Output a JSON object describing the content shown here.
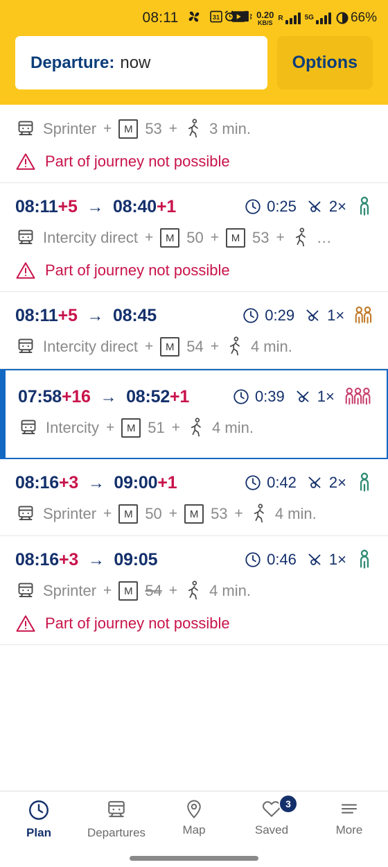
{
  "status_bar": {
    "time": "08:11",
    "left_icons": [
      "photos-pinwheel-icon",
      "calendar-icon",
      "youtube-icon"
    ],
    "calendar_day": "31",
    "alarm_icon": "alarm-icon",
    "vibrate_icon": "vibrate-icon",
    "data_rate_value": "0.20",
    "data_rate_unit": "KB/S",
    "roaming_label": "R",
    "network_label": "5G",
    "battery_percent": "66%"
  },
  "header": {
    "departure_label": "Departure:",
    "departure_value": "now",
    "options_label": "Options"
  },
  "journeys": [
    {
      "partial_top": true,
      "legs": [
        {
          "icon": "train-icon",
          "text": "Sprinter"
        },
        {
          "plus": "+"
        },
        {
          "icon": "metro-badge",
          "badge": "M",
          "text": "53"
        },
        {
          "plus": "+"
        },
        {
          "icon": "walk-icon",
          "text": "3 min."
        }
      ],
      "warning": "Part of journey not possible"
    },
    {
      "departure": "08:11",
      "departure_delay": "+5",
      "arrival": "08:40",
      "arrival_delay": "+1",
      "duration": "0:25",
      "transfers": "2×",
      "crowding": "low",
      "crowding_figures": 1,
      "legs": [
        {
          "icon": "train-icon",
          "text": "Intercity direct"
        },
        {
          "plus": "+"
        },
        {
          "icon": "metro-badge",
          "badge": "M",
          "text": "50"
        },
        {
          "plus": "+"
        },
        {
          "icon": "metro-badge",
          "badge": "M",
          "text": "53"
        },
        {
          "plus": "+"
        },
        {
          "icon": "walk-icon",
          "text": "…"
        }
      ],
      "warning": "Part of journey not possible"
    },
    {
      "departure": "08:11",
      "departure_delay": "+5",
      "arrival": "08:45",
      "arrival_delay": "",
      "duration": "0:29",
      "transfers": "1×",
      "crowding": "medium",
      "crowding_figures": 2,
      "legs": [
        {
          "icon": "train-icon",
          "text": "Intercity direct"
        },
        {
          "plus": "+"
        },
        {
          "icon": "metro-badge",
          "badge": "M",
          "text": "54"
        },
        {
          "plus": "+"
        },
        {
          "icon": "walk-icon",
          "text": "4 min."
        }
      ],
      "warning": ""
    },
    {
      "selected": true,
      "departure": "07:58",
      "departure_delay": "+16",
      "arrival": "08:52",
      "arrival_delay": "+1",
      "duration": "0:39",
      "transfers": "1×",
      "crowding": "high",
      "crowding_figures": 3,
      "legs": [
        {
          "icon": "train-icon",
          "text": "Intercity"
        },
        {
          "plus": "+"
        },
        {
          "icon": "metro-badge",
          "badge": "M",
          "text": "51"
        },
        {
          "plus": "+"
        },
        {
          "icon": "walk-icon",
          "text": "4 min."
        }
      ],
      "warning": ""
    },
    {
      "departure": "08:16",
      "departure_delay": "+3",
      "arrival": "09:00",
      "arrival_delay": "+1",
      "duration": "0:42",
      "transfers": "2×",
      "crowding": "low",
      "crowding_figures": 1,
      "legs": [
        {
          "icon": "train-icon",
          "text": "Sprinter"
        },
        {
          "plus": "+"
        },
        {
          "icon": "metro-badge",
          "badge": "M",
          "text": "50"
        },
        {
          "plus": "+"
        },
        {
          "icon": "metro-badge",
          "badge": "M",
          "text": "53"
        },
        {
          "plus": "+"
        },
        {
          "icon": "walk-icon",
          "text": "4 min."
        }
      ],
      "warning": ""
    },
    {
      "departure": "08:16",
      "departure_delay": "+3",
      "arrival": "09:05",
      "arrival_delay": "",
      "duration": "0:46",
      "transfers": "1×",
      "crowding": "low",
      "crowding_figures": 1,
      "legs": [
        {
          "icon": "train-icon",
          "text": "Sprinter"
        },
        {
          "plus": "+"
        },
        {
          "icon": "metro-badge",
          "badge": "M",
          "text": "54",
          "struck": true
        },
        {
          "plus": "+"
        },
        {
          "icon": "walk-icon",
          "text": "4 min."
        }
      ],
      "warning": "Part of journey not possible"
    }
  ],
  "bottom_nav": [
    {
      "label": "Plan",
      "icon": "clock-icon",
      "active": true
    },
    {
      "label": "Departures",
      "icon": "train-icon",
      "active": false
    },
    {
      "label": "Map",
      "icon": "map-pin-icon",
      "active": false
    },
    {
      "label": "Saved",
      "icon": "heart-icon",
      "active": false,
      "badge": "3"
    },
    {
      "label": "More",
      "icon": "menu-icon",
      "active": false
    }
  ],
  "colors": {
    "brand_yellow": "#FBC71D",
    "navy": "#14306b",
    "crimson": "#C8134B",
    "selected_blue": "#1268C3",
    "crowd_low": "#2E8B73",
    "crowd_medium": "#C07A2A",
    "crowd_high": "#C8436E",
    "muted_grey": "#8a8a8a"
  }
}
